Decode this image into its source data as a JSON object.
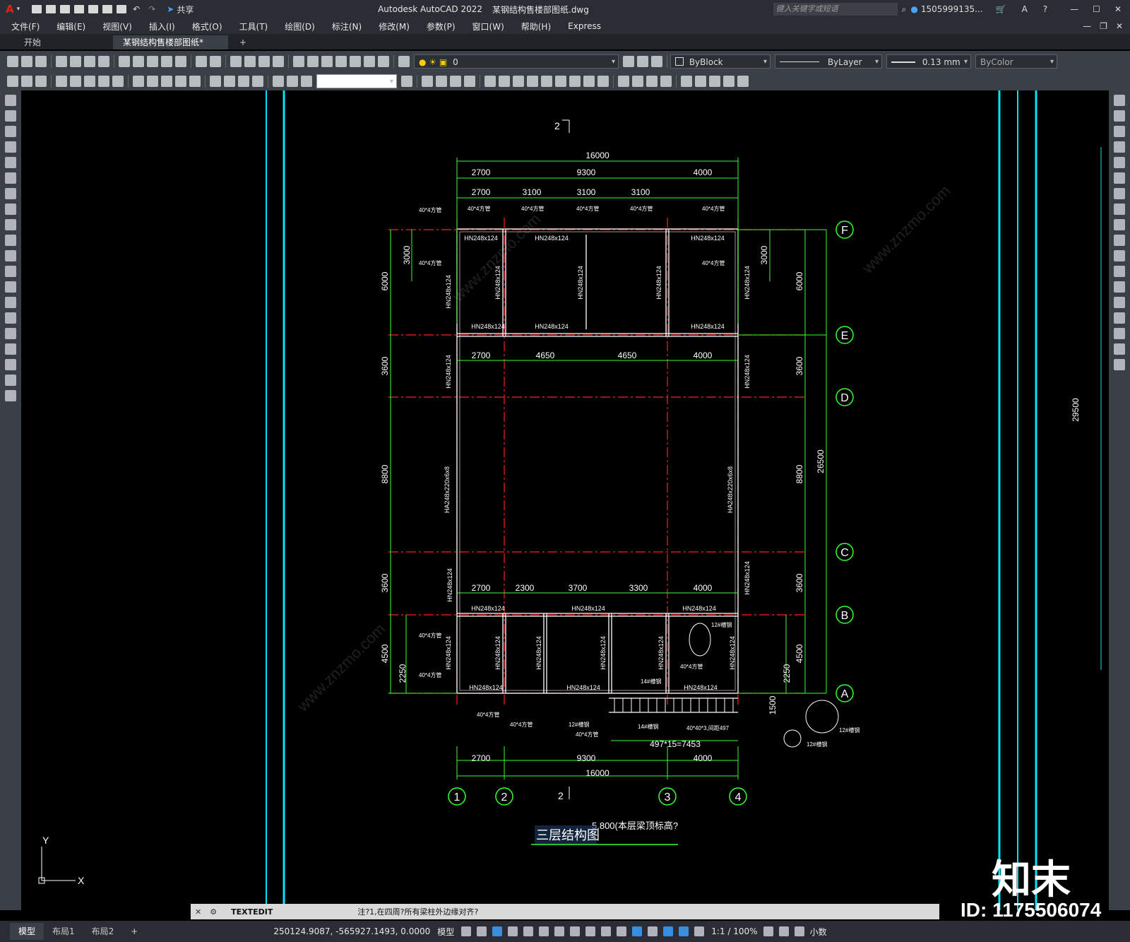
{
  "app": {
    "title": "Autodesk AutoCAD 2022",
    "filename": "某钢结构售楼部图纸.dwg",
    "share": "共享",
    "search_placeholder": "键入关键字或短语",
    "user": "1505999135..."
  },
  "menu": [
    "文件(F)",
    "编辑(E)",
    "视图(V)",
    "插入(I)",
    "格式(O)",
    "工具(T)",
    "绘图(D)",
    "标注(N)",
    "修改(M)",
    "参数(P)",
    "窗口(W)",
    "帮助(H)",
    "Express"
  ],
  "tabs": {
    "start": "开始",
    "active": "某钢结构售楼部图纸*",
    "close": "✕",
    "add": "+"
  },
  "layer": {
    "current": "0"
  },
  "props": {
    "color": "ByBlock",
    "linetype": "ByLayer",
    "lineweight": "0.13 mm",
    "plotstyle": "ByColor"
  },
  "drawing": {
    "dims_top": {
      "total": "16000",
      "row1": [
        "2700",
        "9300",
        "4000"
      ],
      "row2": [
        "2700",
        "3100",
        "3100",
        "3100"
      ]
    },
    "dims_mid_e": [
      "2700",
      "4650",
      "4650",
      "4000"
    ],
    "dims_mid_b": [
      "2700",
      "2300",
      "3700",
      "3300",
      "4000"
    ],
    "dims_bottom": {
      "row1": [
        "2700",
        "9300",
        "4000"
      ],
      "total": "16000"
    },
    "dims_left": [
      "6000",
      "3000",
      "3600",
      "8800",
      "3600",
      "4500",
      "2250"
    ],
    "dims_right": [
      "6000",
      "3000",
      "3600",
      "8800",
      "3600",
      "4500",
      "2250",
      "26500",
      "1500"
    ],
    "dim_far_right": "29500",
    "grid_rows": [
      "F",
      "E",
      "D",
      "C",
      "B",
      "A"
    ],
    "grid_cols": [
      "1",
      "2",
      "3",
      "4"
    ],
    "section_mark": "2",
    "beam": "HN248x124",
    "column": "HA248x220x6x8",
    "tag_40": "40*4方管",
    "tag_12": "12#槽钢",
    "tag_14": "14#槽钢",
    "stair_formula": "497*15=7453",
    "stair_tag": "40*40*3,间距497",
    "elevation": "5.800(本层梁顶标高?",
    "title": "三层结构图",
    "ucs_x": "X",
    "ucs_y": "Y"
  },
  "command": {
    "label": "TEXTEDIT",
    "message": "注?1,在四周?所有梁柱外边缘对齐?"
  },
  "status": {
    "layouts": [
      "模型",
      "布局1",
      "布局2"
    ],
    "coords": "250124.9087, -565927.1493, 0.0000",
    "model": "模型",
    "scale": "1:1 / 100%",
    "units": "小数"
  },
  "watermark": {
    "brand": "知末",
    "id": "ID: 1175506074",
    "site": "www.znzmo.com"
  },
  "colors": {
    "grid_cyan": "#00e5ff",
    "dim_green": "#33ff33",
    "axis_red": "#ff2020",
    "beam_white": "#ffffff"
  }
}
